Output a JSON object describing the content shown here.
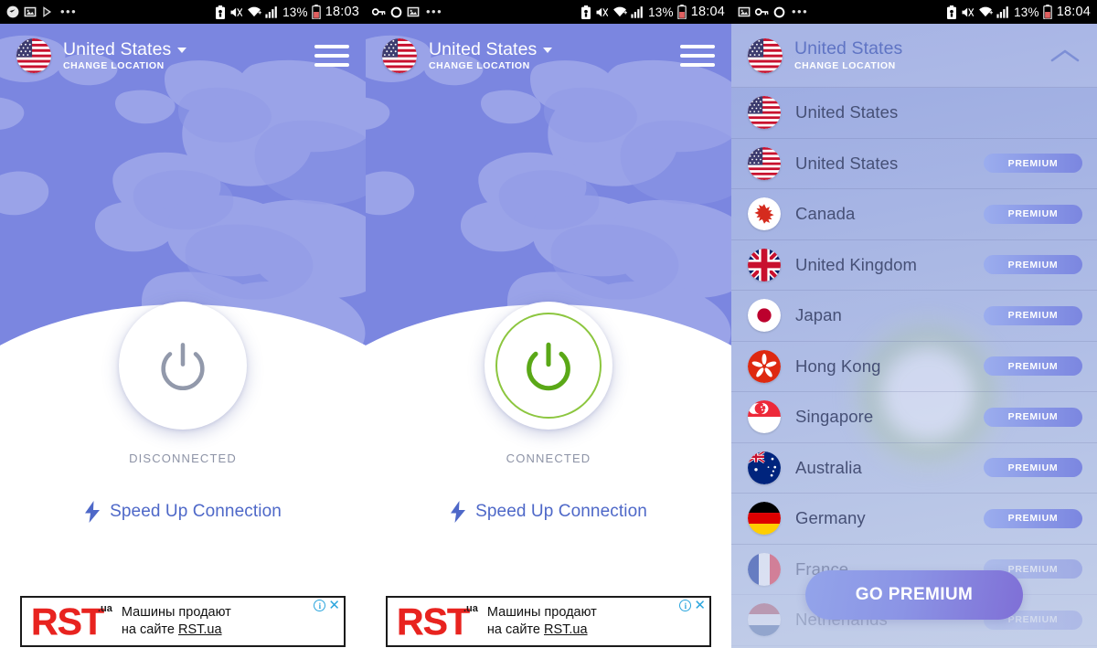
{
  "app": {
    "accent_blue": "#7b86e0",
    "accent_green": "#5aa817",
    "premium_gradient_start": "#9badee",
    "premium_gradient_end": "#7b86e0"
  },
  "panels": [
    {
      "id": "disconnected",
      "statusbar": {
        "left_icons": [
          "location-arrow-icon",
          "image-icon",
          "play-store-icon",
          "overflow-dots-icon"
        ],
        "right_icons": [
          "battery-saver-icon",
          "mute-icon",
          "wifi-icon",
          "signal-icon"
        ],
        "battery_percent": "13%",
        "battery_icon": "battery-icon",
        "time": "18:03"
      },
      "header": {
        "flag": "us-flag-icon",
        "location": "United States",
        "change_location": "CHANGE LOCATION",
        "dropdown_icon": "chevron-down-icon",
        "menu_icon": "hamburger-menu-icon"
      },
      "power": {
        "icon": "power-icon",
        "state": "DISCONNECTED",
        "connected": false
      },
      "speed_up": {
        "icon": "lightning-bolt-icon",
        "label": "Speed Up Connection"
      },
      "ad": {
        "logo": "RST",
        "logo_suffix": ".ua",
        "line1": "Машины продают",
        "line2_prefix": "на сайте ",
        "line2_link": "RST.ua",
        "info_glyph": "i",
        "close_glyph": "✕"
      }
    },
    {
      "id": "connected",
      "statusbar": {
        "left_icons": [
          "vpn-key-icon",
          "circle-icon",
          "image-icon",
          "overflow-dots-icon"
        ],
        "right_icons": [
          "battery-saver-icon",
          "mute-icon",
          "wifi-icon",
          "signal-icon"
        ],
        "battery_percent": "13%",
        "battery_icon": "battery-icon",
        "time": "18:04"
      },
      "header": {
        "flag": "us-flag-icon",
        "location": "United States",
        "change_location": "CHANGE LOCATION",
        "dropdown_icon": "chevron-down-icon",
        "menu_icon": "hamburger-menu-icon"
      },
      "power": {
        "icon": "power-icon",
        "state": "CONNECTED",
        "connected": true
      },
      "speed_up": {
        "icon": "lightning-bolt-icon",
        "label": "Speed Up Connection"
      },
      "ad": {
        "logo": "RST",
        "logo_suffix": ".ua",
        "line1": "Машины продают",
        "line2_prefix": "на сайте ",
        "line2_link": "RST.ua",
        "info_glyph": "i",
        "close_glyph": "✕"
      }
    },
    {
      "id": "location-list",
      "statusbar": {
        "left_icons": [
          "image-icon",
          "vpn-key-icon",
          "circle-icon",
          "overflow-dots-icon"
        ],
        "right_icons": [
          "battery-saver-icon",
          "mute-icon",
          "wifi-icon",
          "signal-icon"
        ],
        "battery_percent": "13%",
        "battery_icon": "battery-icon",
        "time": "18:04"
      },
      "header": {
        "flag": "us-flag-icon",
        "location": "United States",
        "change_location": "CHANGE LOCATION",
        "collapse_icon": "chevron-up-icon"
      },
      "badge_label": "PREMIUM",
      "countries": [
        {
          "name": "United States",
          "flag": "us-flag-icon",
          "premium": false,
          "opacity": "full"
        },
        {
          "name": "United States",
          "flag": "us-flag-icon",
          "premium": true,
          "opacity": "full"
        },
        {
          "name": "Canada",
          "flag": "ca-flag-icon",
          "premium": true,
          "opacity": "full"
        },
        {
          "name": "United Kingdom",
          "flag": "gb-flag-icon",
          "premium": true,
          "opacity": "full"
        },
        {
          "name": "Japan",
          "flag": "jp-flag-icon",
          "premium": true,
          "opacity": "full"
        },
        {
          "name": "Hong Kong",
          "flag": "hk-flag-icon",
          "premium": true,
          "opacity": "full"
        },
        {
          "name": "Singapore",
          "flag": "sg-flag-icon",
          "premium": true,
          "opacity": "full"
        },
        {
          "name": "Australia",
          "flag": "au-flag-icon",
          "premium": true,
          "opacity": "full"
        },
        {
          "name": "Germany",
          "flag": "de-flag-icon",
          "premium": true,
          "opacity": "full"
        },
        {
          "name": "France",
          "flag": "fr-flag-icon",
          "premium": true,
          "opacity": "faded"
        },
        {
          "name": "Netherlands",
          "flag": "nl-flag-icon",
          "premium": true,
          "opacity": "faded2"
        }
      ],
      "cta": {
        "label": "GO PREMIUM"
      }
    }
  ]
}
